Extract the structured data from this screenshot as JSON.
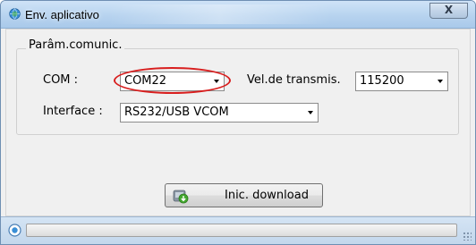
{
  "window": {
    "title": "Env. aplicativo",
    "close_label": "X"
  },
  "group": {
    "label": "Parâm.comunic."
  },
  "fields": {
    "com_label": "COM :",
    "com_value": "COM22",
    "baud_label": "Vel.de transmis.",
    "baud_value": "115200",
    "interface_label": "Interface :",
    "interface_value": "RS232/USB VCOM"
  },
  "actions": {
    "download_label": "Inic. download"
  },
  "status": {
    "progress_fraction": 0
  },
  "colors": {
    "highlight": "#d81e1e",
    "titlebar": "#b7d3ef"
  },
  "icons": {
    "title": "globe-icon",
    "download": "download-icon",
    "status": "status-globe-icon"
  }
}
